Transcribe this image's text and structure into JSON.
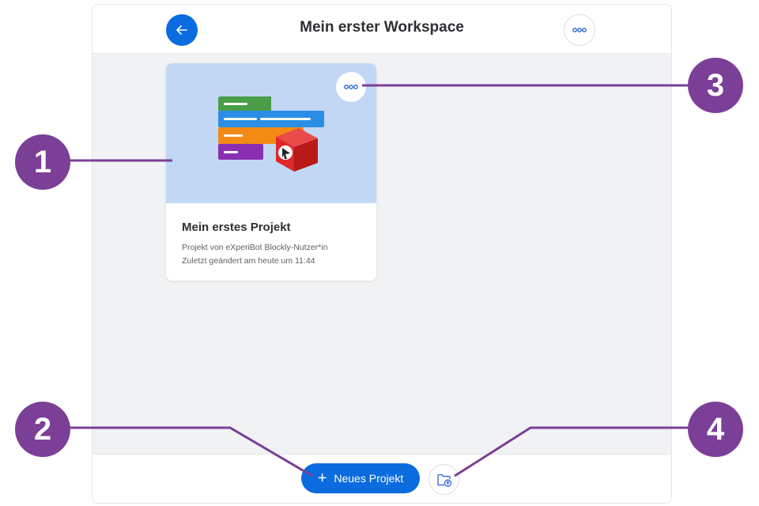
{
  "header": {
    "title": "Mein erster Workspace",
    "back_icon": "arrow-left-icon",
    "more_icon": "more-dots-icon"
  },
  "project": {
    "title": "Mein erstes Projekt",
    "author_line": "Projekt von eXperiBot Blockly-Nutzer*in",
    "modified_line": "Zuletzt geändert am heute um 11:44"
  },
  "footer": {
    "new_project_label": "Neues Projekt",
    "upload_icon": "folder-upload-icon"
  },
  "callouts": [
    "1",
    "2",
    "3",
    "4"
  ],
  "colors": {
    "primary": "#0b6ce0",
    "callout": "#7b3f97",
    "thumb_bg": "#c2d7f4"
  }
}
